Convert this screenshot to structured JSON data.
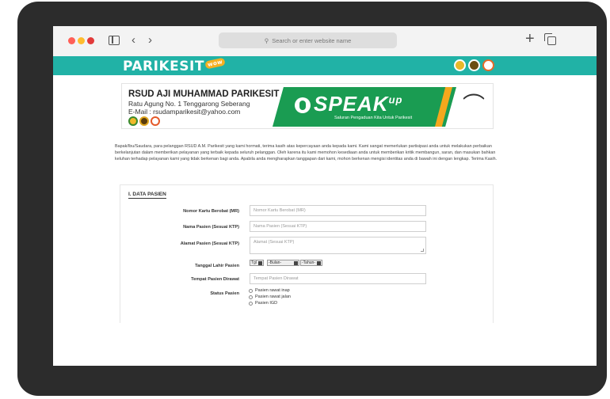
{
  "browser": {
    "url_placeholder": "Search or enter website name",
    "icons": [
      "sidebar-icon",
      "back-icon",
      "forward-icon",
      "search-icon",
      "plus-icon",
      "tabs-icon"
    ]
  },
  "site": {
    "logo": "PARIKESIT",
    "logo_tag": "wow",
    "accent": "#21b2a6"
  },
  "banner": {
    "name": "RSUD AJI MUHAMMAD PARIKESIT",
    "address": "Ratu Agung No. 1 Tenggarong Seberang",
    "email": "E-Mail : rsudamparikesit@yahoo.com",
    "speak": "SPEAK",
    "speak_sup": "up",
    "speak_sub": "Saluran Pengaduan Kita Untuk Parikesit"
  },
  "intro": "Bapak/Ibu/Saudara, para pelanggan RSUD A.M. Parikesit yang kami hormati, terima kasih atas kepercayaan anda kepada kami. Kami sangat memerlukan partisipasi anda untuk melakukan perbaikan berkelanjutan dalam memberikan pelayanan yang terbaik kepada seluruh pelanggan. Oleh karena itu kami memohon kesediaan anda untuk memberikan kritik membangun, saran, dan masukan bahkan keluhan terhadap pelayanan kami yang tidak berkenan bagi anda. Apabila anda mengharapkan tanggapan dari kami, mohon berkenan mengisi identitas anda di bawah ini dengan lengkap. Terima Kasih.",
  "form": {
    "section_title": "I. DATA PASIEN",
    "mr_label": "Nomor Kartu Berobat (MR)",
    "mr_placeholder": "Nomor Kartu Berobat (MR)",
    "name_label": "Nama Pasien (Sesuai KTP)",
    "name_placeholder": "Nama Pasien (Sesuai KTP)",
    "address_label": "Alamat Pasien (Sesuai KTP)",
    "address_placeholder": "Alamat (Sesuai KTP)",
    "dob_label": "Tanggal Lahir Pasien",
    "dob_day": "Tgl",
    "dob_month": "-Bulan-",
    "dob_year": "-Tahun-",
    "place_label": "Tempat Pasien Dirawat",
    "place_placeholder": "Tempat Pasien Dirawat",
    "status_label": "Status Pasien",
    "status_options": [
      "Pasien rawat inap",
      "Pasien rawat jalan",
      "Pasien IGD"
    ]
  }
}
